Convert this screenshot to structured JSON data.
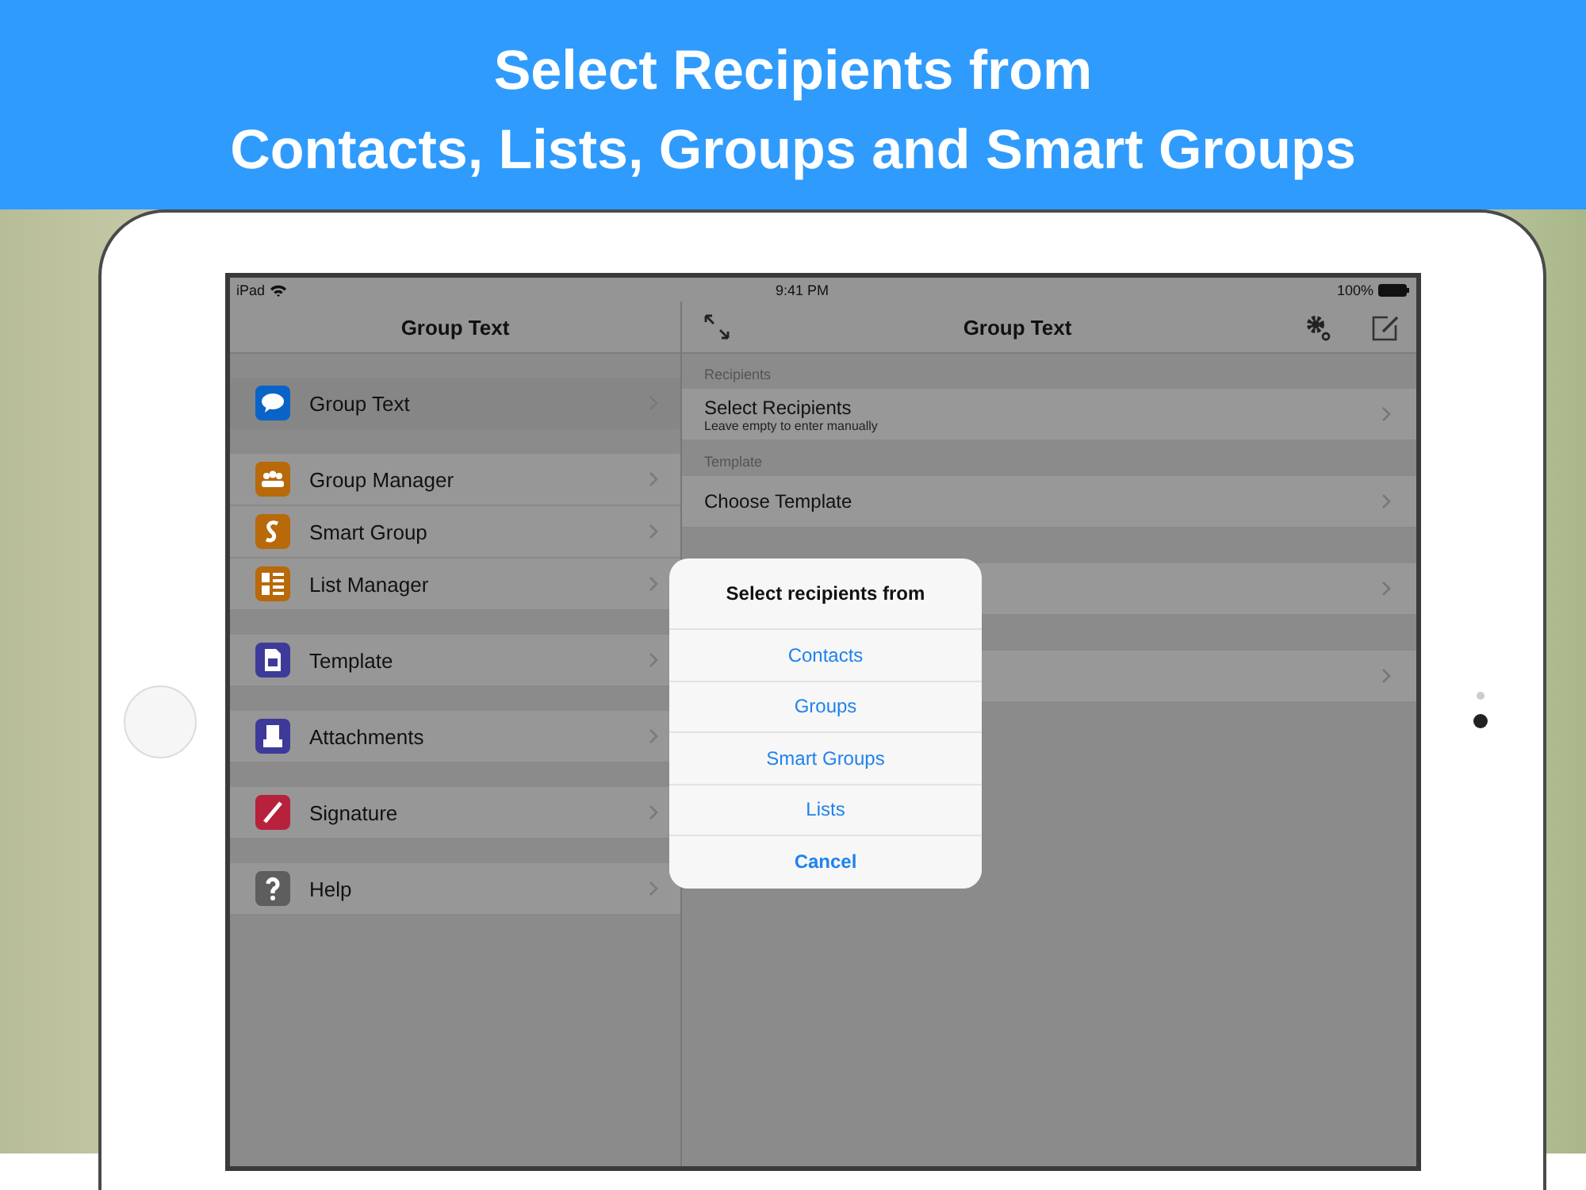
{
  "banner": {
    "lines": [
      "Select Recipients from",
      "Contacts, Lists, Groups and Smart Groups"
    ]
  },
  "status_bar": {
    "carrier": "iPad",
    "time": "9:41 PM",
    "battery": "100%"
  },
  "sidebar": {
    "title": "Group Text",
    "sections": [
      {
        "items": [
          {
            "label": "Group Text",
            "selected": true,
            "color": "#0a64c8"
          }
        ]
      },
      {
        "items": [
          {
            "label": "Group Manager",
            "selected": false,
            "color": "#b8690a"
          },
          {
            "label": "Smart Group",
            "selected": false,
            "color": "#b8690a"
          },
          {
            "label": "List Manager",
            "selected": false,
            "color": "#b8690a"
          }
        ]
      },
      {
        "items": [
          {
            "label": "Template",
            "selected": false,
            "color": "#3e3a99"
          }
        ]
      },
      {
        "items": [
          {
            "label": "Attachments",
            "selected": false,
            "color": "#3e3a99"
          }
        ]
      },
      {
        "items": [
          {
            "label": "Signature",
            "selected": false,
            "color": "#b8213c"
          }
        ]
      },
      {
        "items": [
          {
            "label": "Help",
            "selected": false,
            "color": "#5e5e5e"
          }
        ]
      }
    ]
  },
  "detail": {
    "title": "Group Text",
    "sections": [
      {
        "header": "Recipients",
        "rows": [
          {
            "title": "Select Recipients",
            "subtitle": "Leave empty to enter manually"
          }
        ]
      },
      {
        "header": "Template",
        "rows": [
          {
            "title": "Choose Template"
          }
        ]
      },
      {
        "rows": [
          {}
        ]
      },
      {
        "rows": [
          {}
        ]
      }
    ]
  },
  "alert": {
    "title": "Select recipients from",
    "actions": [
      {
        "label": "Contacts",
        "kind": "default"
      },
      {
        "label": "Groups",
        "kind": "default"
      },
      {
        "label": "Smart Groups",
        "kind": "default"
      },
      {
        "label": "Lists",
        "kind": "default"
      },
      {
        "label": "Cancel",
        "kind": "cancel"
      }
    ]
  }
}
